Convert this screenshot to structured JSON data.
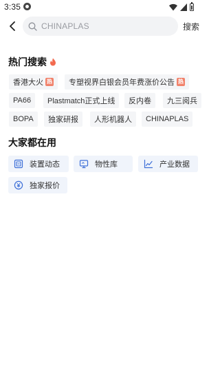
{
  "status": {
    "time": "3:35"
  },
  "search": {
    "placeholder": "CHINAPLAS",
    "button_label": "搜索"
  },
  "hot_search": {
    "title": "热门搜索",
    "hot_badge_text": "热",
    "tags": [
      {
        "label": "香港大火",
        "hot": true
      },
      {
        "label": "专塑视界白银会员年费涨价公告",
        "hot": true
      },
      {
        "label": "PA66",
        "hot": false
      },
      {
        "label": "Plastmatch正式上线",
        "hot": false
      },
      {
        "label": "反内卷",
        "hot": false
      },
      {
        "label": "九三阅兵",
        "hot": false
      },
      {
        "label": "BOPA",
        "hot": false
      },
      {
        "label": "独家研报",
        "hot": false
      },
      {
        "label": "人形机器人",
        "hot": false
      },
      {
        "label": "CHINAPLAS",
        "hot": false
      }
    ]
  },
  "common_tools": {
    "title": "大家都在用",
    "items": [
      {
        "label": "装置动态",
        "icon": "device-icon"
      },
      {
        "label": "物性库",
        "icon": "monitor-icon"
      },
      {
        "label": "产业数据",
        "icon": "chart-icon"
      },
      {
        "label": "独家报价",
        "icon": "yuan-icon"
      }
    ]
  },
  "colors": {
    "accent_blue": "#3d6fd8",
    "hot_badge": "#f1826b",
    "fire": "#f26a4f",
    "tag_bg": "#f4f5f7",
    "tool_bg": "#f0f4fb"
  }
}
